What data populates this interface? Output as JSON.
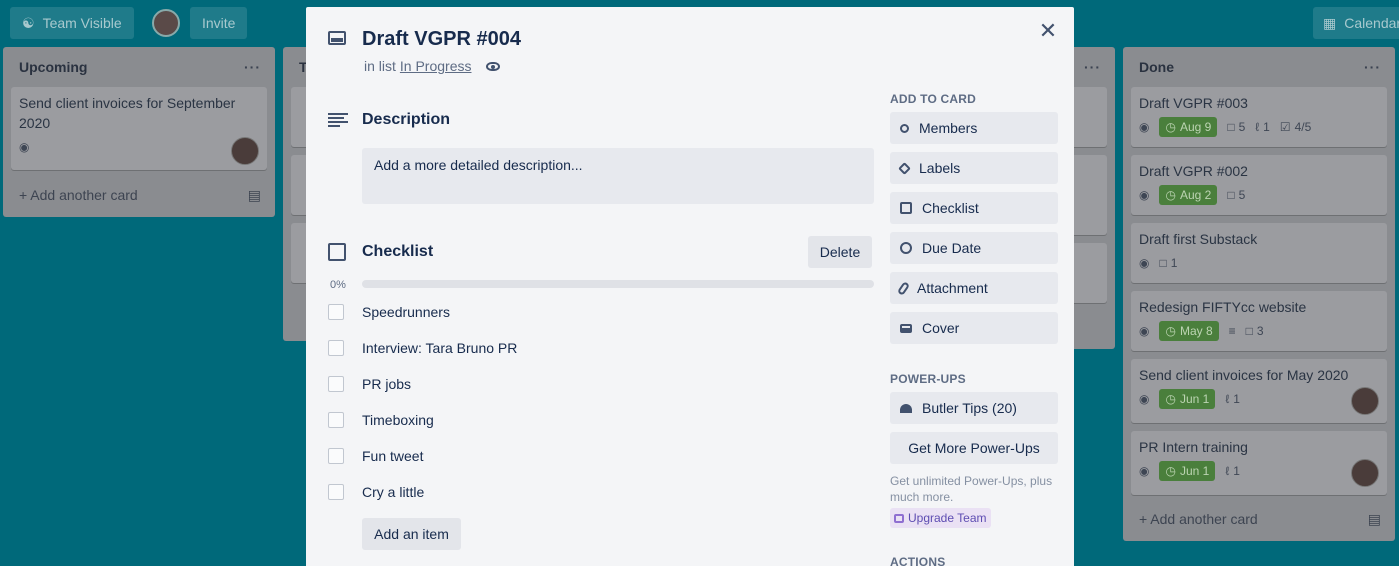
{
  "topbar": {
    "team_visible": "Team Visible",
    "invite": "Invite",
    "calendar": "Calendar"
  },
  "lists": {
    "upcoming": {
      "title": "Upcoming",
      "cards": [
        {
          "title": "Send client invoices for September 2020"
        }
      ],
      "add_card": "Add another card"
    },
    "second_list_initial": "T",
    "done": {
      "title": "Done",
      "cards": [
        {
          "title": "Draft VGPR #003",
          "due": "Aug 9",
          "comments": "5",
          "attachments": "1",
          "checklist": "4/5"
        },
        {
          "title": "Draft VGPR #002",
          "due": "Aug 2",
          "comments": "5"
        },
        {
          "title": "Draft first Substack",
          "comments": "1"
        },
        {
          "title": "Redesign FIFTYcc website",
          "due": "May 8",
          "comments": "3"
        },
        {
          "title": "Send client invoices for May 2020",
          "due": "Jun 1",
          "attachments": "1"
        },
        {
          "title": "PR Intern training",
          "due": "Jun 1",
          "attachments": "1"
        }
      ],
      "add_card": "Add another card"
    }
  },
  "modal": {
    "title": "Draft VGPR #004",
    "in_list_prefix": "in list",
    "list_name": "In Progress",
    "description": {
      "heading": "Description",
      "placeholder": "Add a more detailed description..."
    },
    "checklist": {
      "heading": "Checklist",
      "delete": "Delete",
      "percent": "0%",
      "progress": 0,
      "items": [
        {
          "text": "Speedrunners",
          "checked": false
        },
        {
          "text": "Interview: Tara Bruno PR",
          "checked": false
        },
        {
          "text": "PR jobs",
          "checked": false
        },
        {
          "text": "Timeboxing",
          "checked": false
        },
        {
          "text": "Fun tweet",
          "checked": false
        },
        {
          "text": "Cry a little",
          "checked": false
        }
      ],
      "add_item": "Add an item"
    },
    "sidebar": {
      "add_to_card": "ADD TO CARD",
      "buttons": [
        "Members",
        "Labels",
        "Checklist",
        "Due Date",
        "Attachment",
        "Cover"
      ],
      "power_ups": "POWER-UPS",
      "butler": "Butler Tips (20)",
      "get_more": "Get More Power-Ups",
      "note": "Get unlimited Power-Ups, plus much more.",
      "upgrade": "Upgrade Team",
      "actions": "ACTIONS"
    }
  },
  "colors": {
    "board_bg": "#00697a",
    "due_green": "#4a7f3c",
    "progress_blue": "#5ba4cf",
    "modal_bg": "#f4f5f7"
  }
}
